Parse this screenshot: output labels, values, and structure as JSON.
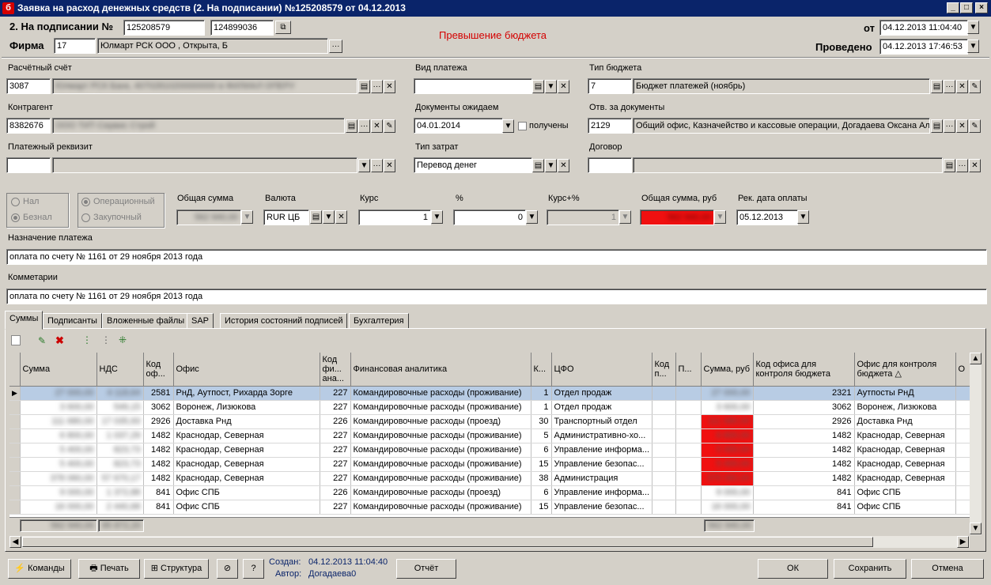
{
  "window": {
    "title": "Заявка на расход денежных средств (2. На подписании) №125208579 от 04.12.2013",
    "icon": "б"
  },
  "header": {
    "status_label": "2. На подписании №",
    "doc_number": "125208579",
    "doc_number2": "124899036",
    "firm_label": "Фирма",
    "firm_code": "17",
    "firm_name": "Юлмарт РСК ООО , Открыта, Б",
    "warning": "Превышение бюджета",
    "from_label": "от",
    "from_date": "04.12.2013 11:04:40",
    "posted_label": "Проведено",
    "posted_date": "04.12.2013 17:46:53"
  },
  "form": {
    "account_label": "Расчётный счёт",
    "account_code": "3087",
    "account_name": "Юлмарт РСК Банк, 40702810200000000 в ФИЛИАЛ ОПЕРУ",
    "payment_type_label": "Вид платежа",
    "payment_type": "",
    "budget_type_label": "Тип бюджета",
    "budget_type_code": "7",
    "budget_type_name": "Бюджет платежей (ноябрь)",
    "contractor_label": "Контрагент",
    "contractor_code": "8382676",
    "contractor_name": "ООО ТИТ-Сервис Строй",
    "docs_expected_label": "Документы ожидаем",
    "docs_expected_date": "04.01.2014",
    "received_label": "получены",
    "resp_docs_label": "Отв. за документы",
    "resp_docs_code": "2129",
    "resp_docs_name": "Общий офис, Казначейство и кассовые операции, Догадаева  Оксана Алексеевна",
    "payment_req_label": "Платежный реквизит",
    "payment_req_code": "",
    "payment_req_name": "",
    "cost_type_label": "Тип затрат",
    "cost_type": "Перевод денег",
    "contract_label": "Договор",
    "contract_code": "",
    "contract_name": ""
  },
  "payment": {
    "cash_label": "Нал",
    "noncash_label": "Безнал",
    "operational_label": "Операционный",
    "purchase_label": "Закупочный",
    "total_label": "Общая сумма",
    "total_value": "562 940,00",
    "currency_label": "Валюта",
    "currency": "RUR ЦБ",
    "rate_label": "Курс",
    "rate": "1",
    "percent_label": "%",
    "percent": "0",
    "rate_pct_label": "Курс+%",
    "rate_pct": "1",
    "total_rub_label": "Общая сумма, руб",
    "total_rub": "562 940,00",
    "rec_date_label": "Рек. дата оплаты",
    "rec_date": "05.12.2013"
  },
  "purpose": {
    "label": "Назначение платежа",
    "text": "оплата по счету № 1161 от  29 ноября 2013 года"
  },
  "comments": {
    "label": "Комметарии",
    "text": "оплата по счету № 1161 от  29 ноября 2013 года"
  },
  "tabs": [
    "Суммы",
    "Подписанты",
    "Вложенные файлы",
    "SAP",
    "История состояний подписей",
    "Бухгалтерия"
  ],
  "grid": {
    "columns": [
      "Сумма",
      "НДС",
      "Код оф...",
      "Офис",
      "Код фи... ана...",
      "Финансовая аналитика",
      "К...",
      "ЦФО",
      "Код п...",
      "П...",
      "Сумма, руб",
      "Код офиса для контроля бюджета",
      "Офис для контроля бюджета",
      "О"
    ],
    "rows": [
      {
        "sum": "27 000,00",
        "vat": "4 118,64",
        "office_code": "2581",
        "office": "РнД, Аутпост, Рихарда Зорге",
        "fa_code": "227",
        "fa": "Командировочные расходы (проживание)",
        "k": "1",
        "cfo": "Отдел продаж",
        "sum_rub": "27 000,00",
        "red": true,
        "ctrl_code": "2321",
        "ctrl_office": "Аутпосты РнД"
      },
      {
        "sum": "3 600,00",
        "vat": "549,15",
        "office_code": "3062",
        "office": "Воронеж, Лизюкова",
        "fa_code": "227",
        "fa": "Командировочные расходы (проживание)",
        "k": "1",
        "cfo": "Отдел продаж",
        "sum_rub": "3 600,00",
        "red": false,
        "ctrl_code": "3062",
        "ctrl_office": "Воронеж, Лизюкова"
      },
      {
        "sum": "111 680,00",
        "vat": "17 035,93",
        "office_code": "2926",
        "office": "Доставка Рнд",
        "fa_code": "226",
        "fa": "Командировочные расходы (проезд)",
        "k": "30",
        "cfo": "Транспортный отдел",
        "sum_rub": "111 680,00",
        "red": true,
        "ctrl_code": "2926",
        "ctrl_office": "Доставка Рнд"
      },
      {
        "sum": "6 800,00",
        "vat": "1 037,29",
        "office_code": "1482",
        "office": "Краснодар, Северная",
        "fa_code": "227",
        "fa": "Командировочные расходы (проживание)",
        "k": "5",
        "cfo": "Административно-хо...",
        "sum_rub": "6 800,00",
        "red": true,
        "ctrl_code": "1482",
        "ctrl_office": "Краснодар, Северная"
      },
      {
        "sum": "5 400,00",
        "vat": "823,73",
        "office_code": "1482",
        "office": "Краснодар, Северная",
        "fa_code": "227",
        "fa": "Командировочные расходы (проживание)",
        "k": "6",
        "cfo": "Управление информа...",
        "sum_rub": "5 400,00",
        "red": true,
        "ctrl_code": "1482",
        "ctrl_office": "Краснодар, Северная"
      },
      {
        "sum": "5 400,00",
        "vat": "823,73",
        "office_code": "1482",
        "office": "Краснодар, Северная",
        "fa_code": "227",
        "fa": "Командировочные расходы (проживание)",
        "k": "15",
        "cfo": "Управление безопас...",
        "sum_rub": "5 400,00",
        "red": true,
        "ctrl_code": "1482",
        "ctrl_office": "Краснодар, Северная"
      },
      {
        "sum": "378 060,00",
        "vat": "57 670,17",
        "office_code": "1482",
        "office": "Краснодар, Северная",
        "fa_code": "227",
        "fa": "Командировочные расходы (проживание)",
        "k": "38",
        "cfo": "Администрация",
        "sum_rub": "378 060,00",
        "red": true,
        "ctrl_code": "1482",
        "ctrl_office": "Краснодар, Северная"
      },
      {
        "sum": "9 000,00",
        "vat": "1 372,88",
        "office_code": "841",
        "office": "Офис СПБ",
        "fa_code": "226",
        "fa": "Командировочные расходы (проезд)",
        "k": "6",
        "cfo": "Управление информа...",
        "sum_rub": "9 000,00",
        "red": false,
        "ctrl_code": "841",
        "ctrl_office": "Офис СПБ"
      },
      {
        "sum": "16 000,00",
        "vat": "2 440,68",
        "office_code": "841",
        "office": "Офис СПБ",
        "fa_code": "227",
        "fa": "Командировочные расходы (проживание)",
        "k": "15",
        "cfo": "Управление безопас...",
        "sum_rub": "16 000,00",
        "red": false,
        "ctrl_code": "841",
        "ctrl_office": "Офис СПБ"
      }
    ],
    "totals": {
      "sum": "562 940,00",
      "vat": "85 872,20",
      "sum_rub": "562 940,00"
    }
  },
  "footer": {
    "commands": "Команды",
    "print": "Печать",
    "structure": "Структура",
    "help": "?",
    "created_label": "Создан:",
    "created_value": "04.12.2013 11:04:40",
    "author_label": "Автор:",
    "author_value": "Догадаева0",
    "report": "Отчёт",
    "ok": "ОК",
    "save": "Сохранить",
    "cancel": "Отмена"
  },
  "colors": {
    "title_bg": "#0a246a",
    "warning": "#d40000",
    "over_budget": "#f01010",
    "selection": "#b8cce4",
    "window_bg": "#d4d0c8"
  }
}
